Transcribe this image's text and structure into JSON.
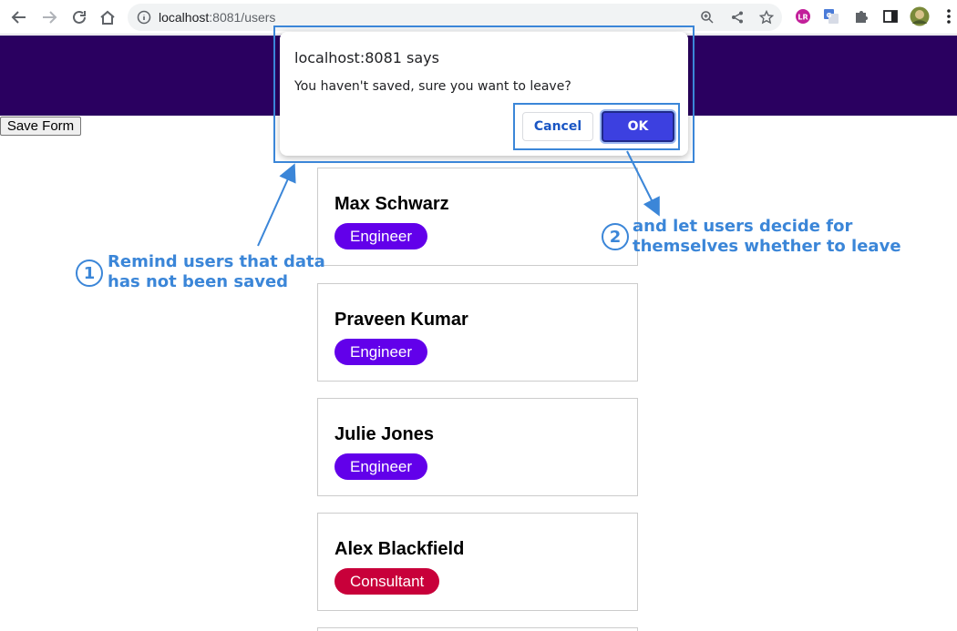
{
  "browser": {
    "url_host": "localhost",
    "url_rest": ":8081/users",
    "icons": [
      "back-icon",
      "forward-icon",
      "reload-icon",
      "home-icon",
      "info-icon",
      "zoom-icon",
      "share-icon",
      "star-icon",
      "extension-lr-icon",
      "translate-icon",
      "puzzle-icon",
      "sidepanel-icon",
      "profile-avatar",
      "menu-icon"
    ]
  },
  "page": {
    "header_color": "#2a0060",
    "save_button": "Save Form"
  },
  "users": [
    {
      "name": "Max Schwarz",
      "role": "Engineer",
      "role_color": "#6200ea"
    },
    {
      "name": "Praveen Kumar",
      "role": "Engineer",
      "role_color": "#6200ea"
    },
    {
      "name": "Julie Jones",
      "role": "Engineer",
      "role_color": "#6200ea"
    },
    {
      "name": "Alex Blackfield",
      "role": "Consultant",
      "role_color": "#c8003a"
    }
  ],
  "dialog": {
    "title": "localhost:8081 says",
    "message": "You haven't saved, sure you want to leave?",
    "cancel": "Cancel",
    "ok": "OK"
  },
  "annotations": {
    "one_num": "1",
    "one_line1": "Remind users that data",
    "one_line2": "has not been saved",
    "two_num": "2",
    "two_line1": "and let users decide for",
    "two_line2": "themselves whether to leave",
    "color": "#3b86d8"
  }
}
